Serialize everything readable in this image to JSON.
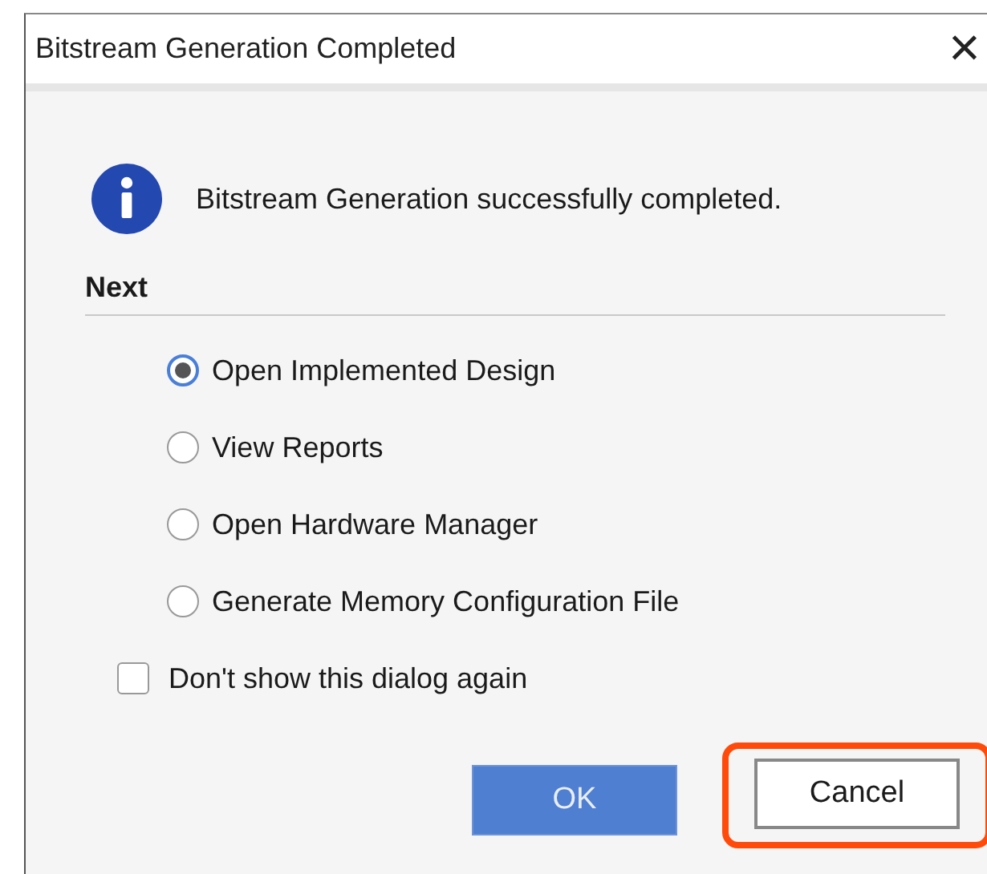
{
  "window": {
    "title": "Bitstream Generation Completed",
    "close": "×"
  },
  "message": {
    "kind": "info",
    "text": "Bitstream Generation successfully completed."
  },
  "section": {
    "title": "Next"
  },
  "options": [
    {
      "label": "Open Implemented Design",
      "selected": true
    },
    {
      "label": "View Reports",
      "selected": false
    },
    {
      "label": "Open Hardware Manager",
      "selected": false
    },
    {
      "label": "Generate Memory Configuration File",
      "selected": false
    }
  ],
  "dont_show_again": {
    "label": "Don't show this dialog again",
    "checked": false
  },
  "buttons": [
    {
      "label": "OK",
      "kind": "primary",
      "highlighted": false
    },
    {
      "label": "Cancel",
      "kind": "secondary",
      "highlighted": true
    }
  ]
}
